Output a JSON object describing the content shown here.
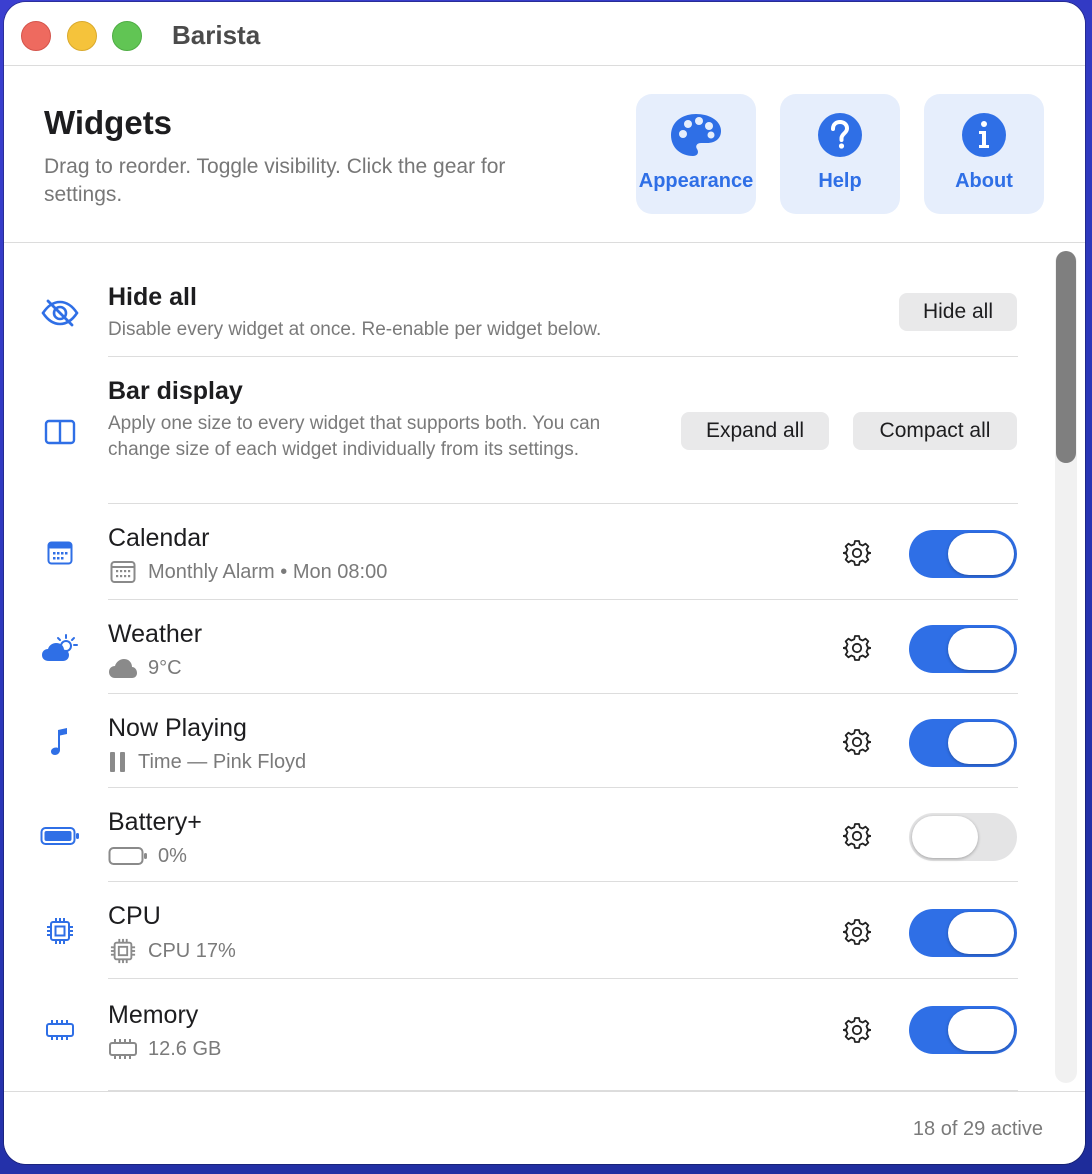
{
  "window": {
    "title": "Barista"
  },
  "header": {
    "title": "Widgets",
    "subtitle": "Drag to reorder. Toggle visibility. Click the gear for settings.",
    "tiles": [
      {
        "label": "Appearance",
        "icon": "palette-icon"
      },
      {
        "label": "Help",
        "icon": "question-circle-icon"
      },
      {
        "label": "About",
        "icon": "info-circle-icon"
      }
    ]
  },
  "hide_all": {
    "title": "Hide all",
    "subtitle": "Disable every widget at once. Re-enable per widget below.",
    "button": "Hide all",
    "icon": "eye-slash-icon"
  },
  "bar_display": {
    "title": "Bar display",
    "subtitle": "Apply one size to every widget that supports both. You can change size of each widget individually from its settings.",
    "expand_button": "Expand all",
    "compact_button": "Compact all",
    "icon": "split-rectangle-icon"
  },
  "widgets": [
    {
      "name": "Calendar",
      "status": "Monthly Alarm • Mon 08:00",
      "enabled": true,
      "icon": "calendar-icon",
      "status_icon": "calendar-icon"
    },
    {
      "name": "Weather",
      "status": "9°C",
      "enabled": true,
      "icon": "cloud-sun-icon",
      "status_icon": "cloud-icon"
    },
    {
      "name": "Now Playing",
      "status": "Time — Pink Floyd",
      "enabled": true,
      "icon": "music-note-icon",
      "status_icon": "pause-icon"
    },
    {
      "name": "Battery+",
      "status": "0%",
      "enabled": false,
      "icon": "battery-full-icon",
      "status_icon": "battery-empty-icon"
    },
    {
      "name": "CPU",
      "status": "CPU 17%",
      "enabled": true,
      "icon": "cpu-icon",
      "status_icon": "cpu-icon"
    },
    {
      "name": "Memory",
      "status": "12.6 GB",
      "enabled": true,
      "icon": "memory-chip-icon",
      "status_icon": "memory-chip-icon"
    }
  ],
  "footer": {
    "active_count": "18 of 29 active"
  },
  "colors": {
    "accent": "#2f6fe6",
    "tile_bg": "#e6eefc",
    "toggle_off": "#e4e4e5"
  }
}
